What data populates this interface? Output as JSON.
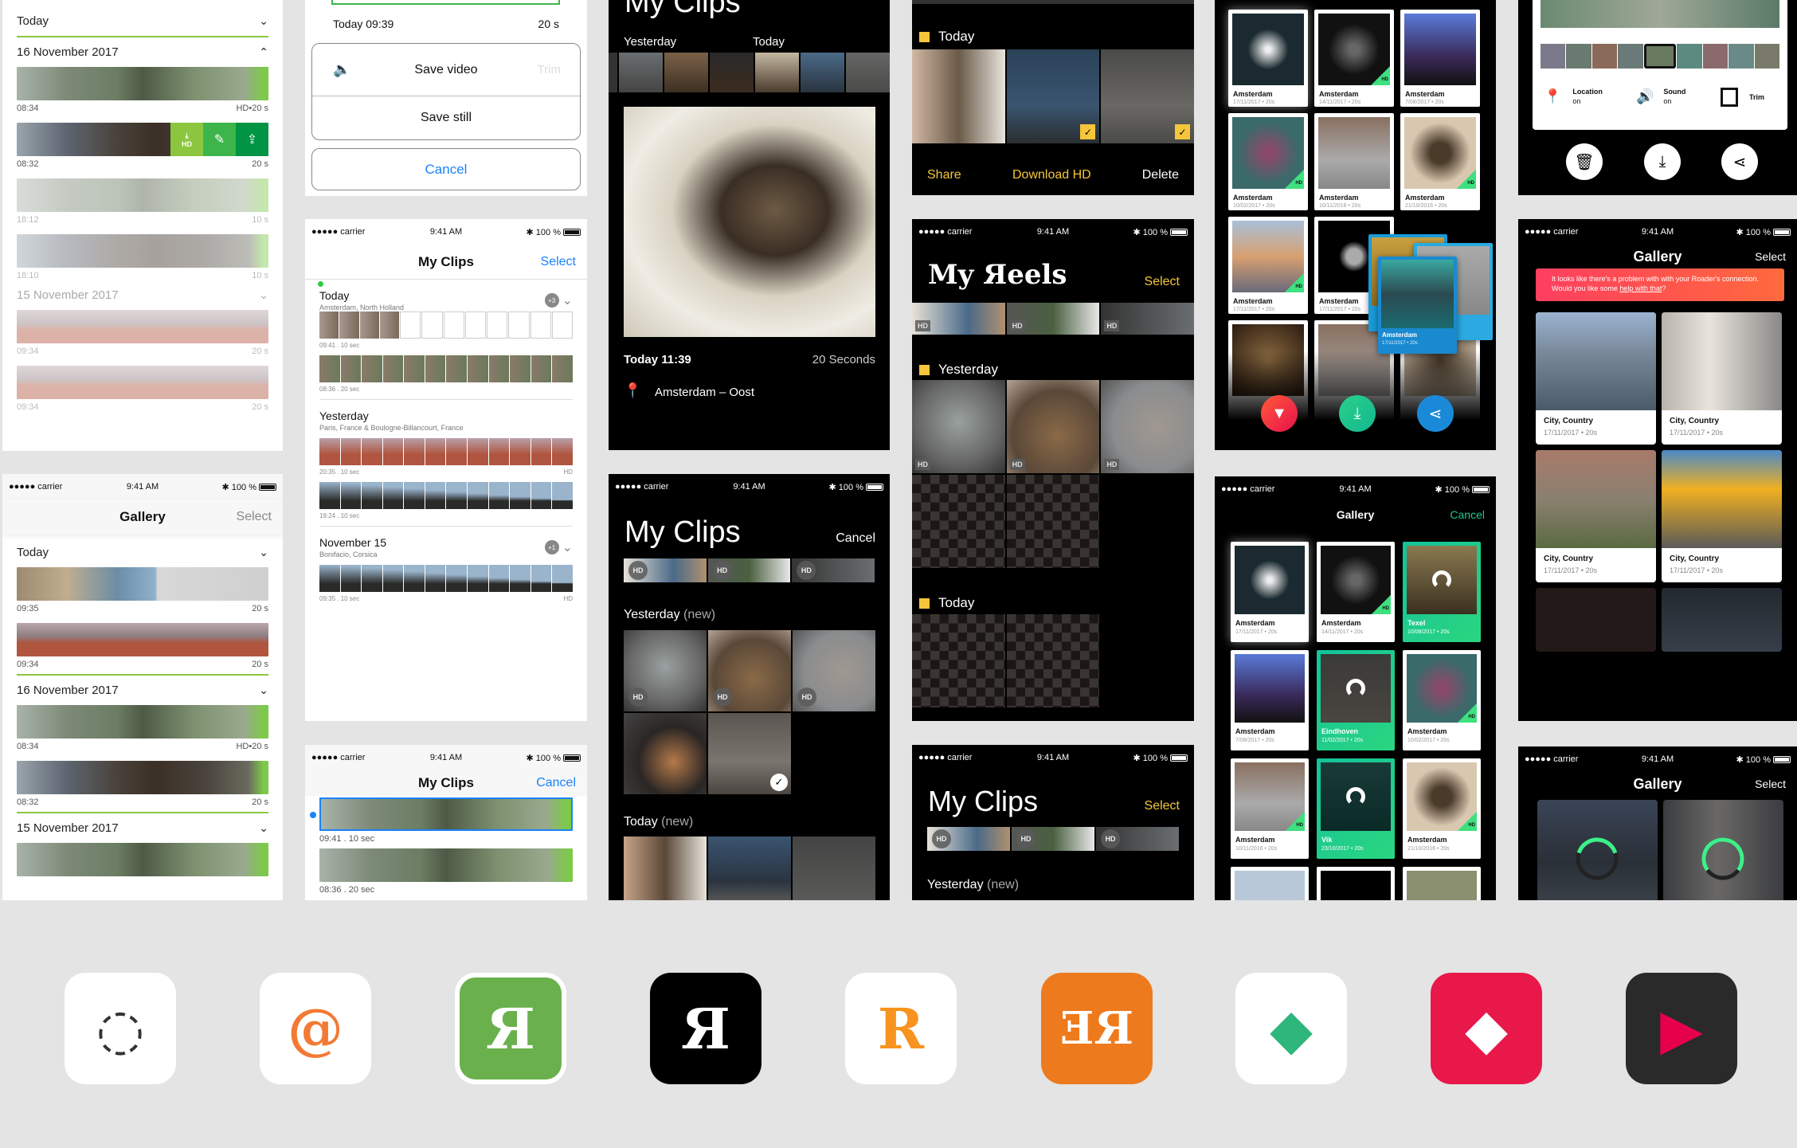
{
  "status_bar": {
    "carrier": "●●●●● carrier",
    "wifi": "wifi",
    "time": "9:41 AM",
    "battery": "100 %"
  },
  "screen1": {
    "sections": [
      {
        "title": "Today",
        "expanded": false
      },
      {
        "title": "16 November 2017",
        "expanded": true
      },
      {
        "title": "15 November 2017",
        "expanded": false
      }
    ],
    "clips": [
      {
        "time": "08:34",
        "meta": "HD•20 s"
      },
      {
        "time": "08:32",
        "meta": "20 s"
      },
      {
        "time": "18:12",
        "meta": "10 s"
      },
      {
        "time": "18:10",
        "meta": "10 s"
      },
      {
        "time": "09:34",
        "meta": "20 s"
      },
      {
        "time": "09:34",
        "meta": "20 s"
      }
    ],
    "swipe_actions": {
      "download_hd": "HD",
      "edit": "edit",
      "share": "share"
    }
  },
  "screen2": {
    "title": "Gallery",
    "select": "Select",
    "sections": [
      "Today",
      "16 November 2017",
      "15 November 2017"
    ],
    "clips": [
      {
        "time": "09:35",
        "meta": "20 s"
      },
      {
        "time": "09:34",
        "meta": "20 s"
      },
      {
        "time": "08:34",
        "meta": "HD•20 s"
      },
      {
        "time": "08:32",
        "meta": "20 s"
      }
    ]
  },
  "screen3": {
    "header_left": "Today 09:39",
    "header_right": "20 s",
    "save_video": "Save video",
    "save_still": "Save still",
    "trim": "Trim",
    "cancel": "Cancel"
  },
  "screen4": {
    "title": "My Clips",
    "select": "Select",
    "groups": [
      {
        "title": "Today",
        "subtitle": "Amsterdam, North Holland",
        "badge": "+3",
        "clips": [
          {
            "meta": "09:41 . 10 sec"
          },
          {
            "meta": "08:36  . 20 sec"
          }
        ]
      },
      {
        "title": "Yesterday",
        "subtitle": "Paris, France & Boulogne-Billancourt, France",
        "badge": "",
        "clips": [
          {
            "meta": "20:35 . 10 sec",
            "hd": "HD"
          },
          {
            "meta": "19:24 . 10 sec"
          }
        ]
      },
      {
        "title": "November 15",
        "subtitle": "Bonifacio, Corsica",
        "badge": "+1",
        "clips": [
          {
            "meta": "09:35 . 10 sec",
            "hd": "HD"
          }
        ]
      }
    ]
  },
  "screen5": {
    "title": "My Clips",
    "cancel": "Cancel",
    "clips": [
      {
        "meta": "09:41 . 10 sec"
      },
      {
        "meta": "08:36 . 20 sec"
      }
    ]
  },
  "screen6": {
    "title": "My Clips",
    "tab_yesterday": "Yesterday",
    "tab_today": "Today",
    "date": "Today 11:39",
    "duration": "20 Seconds",
    "location": "Amsterdam – Oost"
  },
  "screen7": {
    "title": "My Clips",
    "cancel": "Cancel",
    "hd": "HD",
    "section1": "Yesterday",
    "section1_new": "(new)",
    "section2": "Today",
    "section2_new": "(new)"
  },
  "screen8": {
    "today": "Today",
    "share": "Share",
    "download": "Download HD",
    "delete": "Delete"
  },
  "screen9": {
    "title": "My Яeels",
    "select": "Select",
    "hd": "HD",
    "yesterday": "Yesterday",
    "today": "Today"
  },
  "screen10": {
    "title": "My Clips",
    "select": "Select",
    "hd": "HD",
    "section": "Yesterday",
    "section_new": "(new)"
  },
  "screen11": {
    "cards": [
      {
        "place": "Amsterdam",
        "meta": "17/11/2017 • 20s"
      },
      {
        "place": "Amsterdam",
        "meta": "14/11/2017 • 20s",
        "hd": true
      },
      {
        "place": "Amsterdam",
        "meta": "7/08/2017 • 20s"
      },
      {
        "place": "Amsterdam",
        "meta": "10/02/2017 • 20s",
        "hd": true
      },
      {
        "place": "Amsterdam",
        "meta": "10/11/2016 • 20s"
      },
      {
        "place": "Amsterdam",
        "meta": "21/10/2016 • 20s",
        "hd": true
      },
      {
        "place": "Amsterdam",
        "meta": "17/11/2017 • 20s",
        "hd": true
      },
      {
        "place": "Amsterdam",
        "meta": "17/11/2017 • 20s"
      }
    ],
    "drag_card": {
      "place": "Amsterdam",
      "meta": "17/11/2017 • 20s"
    },
    "hd": "HD"
  },
  "screen12": {
    "title": "Gallery",
    "cancel": "Cancel",
    "cards": [
      {
        "place": "Amsterdam",
        "meta": "17/11/2017 • 20s",
        "selected": false
      },
      {
        "place": "Amsterdam",
        "meta": "14/11/2017 • 20s",
        "selected": false
      },
      {
        "place": "Texel",
        "meta": "10/08/2017 • 20s",
        "selected": true
      },
      {
        "place": "Amsterdam",
        "meta": "7/08/2017 • 20s",
        "selected": false
      },
      {
        "place": "Eindhoven",
        "meta": "11/02/2017 • 20s",
        "selected": true
      },
      {
        "place": "Amsterdam",
        "meta": "10/02/2017 • 20s",
        "selected": false
      },
      {
        "place": "Amsterdam",
        "meta": "10/11/2016 • 20s",
        "selected": false
      },
      {
        "place": "Vik",
        "meta": "23/10/2017 • 20s",
        "selected": true
      },
      {
        "place": "Amsterdam",
        "meta": "21/10/2016 • 20s",
        "selected": false
      }
    ],
    "hd": "HD"
  },
  "screen13": {
    "location_label": "Location",
    "location_value": "on",
    "sound_label": "Sound",
    "sound_value": "on",
    "trim_label": "Trim"
  },
  "screen14": {
    "title": "Gallery",
    "select": "Select",
    "banner_text": "It looks like there's a problem with with your Roader's connection. Would you like some ",
    "banner_link": "help with that",
    "banner_end": "?",
    "cards": [
      {
        "place": "City, Country",
        "meta": "17/11/2017 • 20s"
      },
      {
        "place": "City, Country",
        "meta": "17/11/2017 • 20s"
      },
      {
        "place": "City, Country",
        "meta": "17/11/2017 • 20s"
      },
      {
        "place": "City, Country",
        "meta": "17/11/2017 • 20s"
      }
    ]
  },
  "screen15": {
    "title": "Gallery",
    "select": "Select",
    "progress": [
      0.4,
      0.7
    ]
  },
  "app_icons": [
    {
      "name": "circle-swirl-icon",
      "glyph": "◌",
      "bg": "#ffffff",
      "fg": "#333333"
    },
    {
      "name": "orange-camera-spiral-icon",
      "glyph": "@",
      "bg": "#ffffff",
      "fg": "#f27a35"
    },
    {
      "name": "green-camera-r-icon",
      "glyph": "Я",
      "bg": "#6ab04c",
      "fg": "#ffffff"
    },
    {
      "name": "black-r-icon",
      "glyph": "Я",
      "bg": "#000000",
      "fg": "#ffffff"
    },
    {
      "name": "orange-chevron-r-icon",
      "glyph": "R",
      "bg": "#ffffff",
      "fg": "#f7931e"
    },
    {
      "name": "orange-er-icon",
      "glyph": "ƎЯ",
      "bg": "#ee7a1e",
      "fg": "#ffffff"
    },
    {
      "name": "green-diamond-icon",
      "glyph": "◆",
      "bg": "#ffffff",
      "fg": "#2fb67c"
    },
    {
      "name": "red-split-diamond-icon",
      "glyph": "◆",
      "bg": "#e8184b",
      "fg": "#ffffff"
    },
    {
      "name": "dark-pink-play-icon",
      "glyph": "▶",
      "bg": "#2a2a2a",
      "fg": "#e6004c"
    }
  ],
  "colors": {
    "green": "#8cc63f",
    "blue": "#1a82fb",
    "yellow": "#f5c63b",
    "teal": "#19c792",
    "red": "#ff4d5a"
  }
}
